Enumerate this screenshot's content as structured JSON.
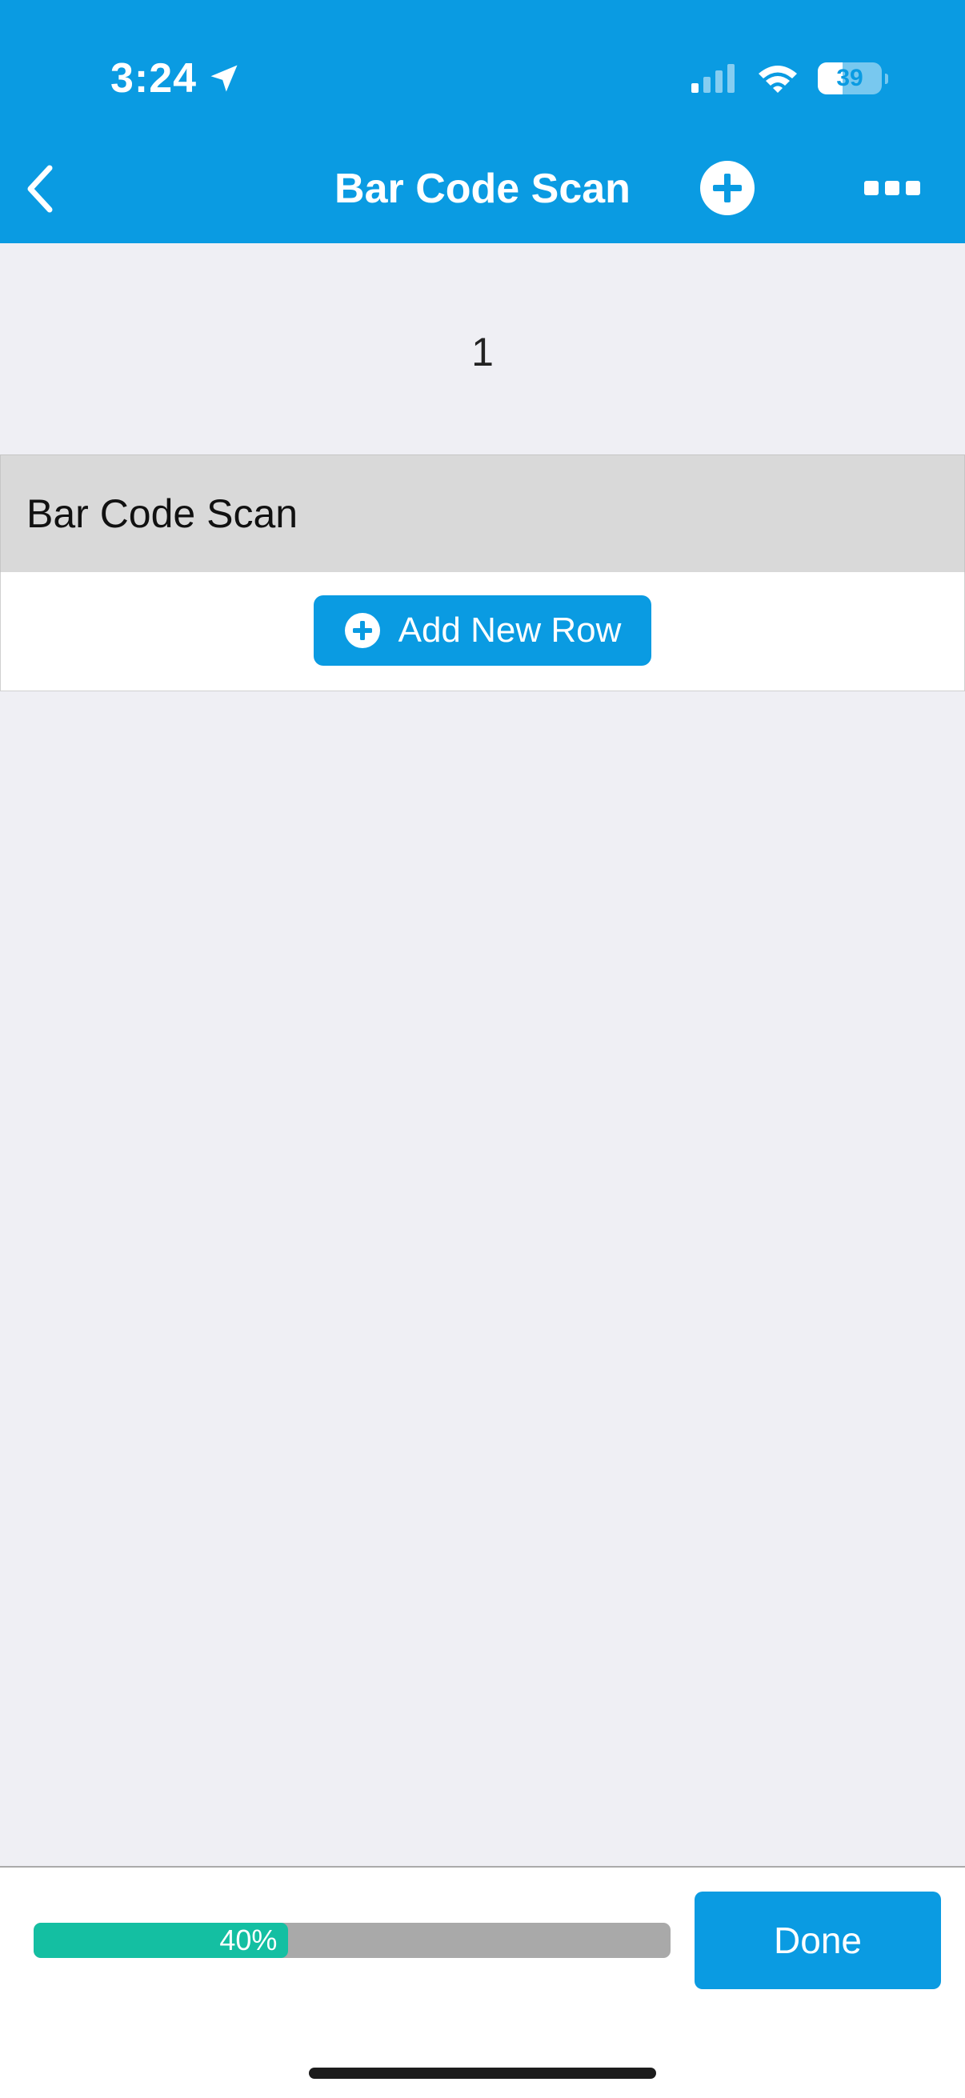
{
  "status_bar": {
    "time": "3:24",
    "battery_level": "39",
    "icons": [
      "location-arrow-icon",
      "signal-icon",
      "wifi-icon",
      "battery-icon"
    ]
  },
  "nav": {
    "title": "Bar Code Scan",
    "icons": [
      "back-chevron-icon",
      "add-circle-icon",
      "more-icon"
    ]
  },
  "content": {
    "count": "1",
    "section_title": "Bar Code Scan",
    "add_row_label": "Add New Row"
  },
  "footer": {
    "progress_value": 0.4,
    "progress_label": "40%",
    "done_label": "Done"
  },
  "colors": {
    "primary": "#0a9be2",
    "progress_fill": "#14bfa2",
    "progress_track": "#a9a9a9",
    "background": "#efeff4"
  }
}
